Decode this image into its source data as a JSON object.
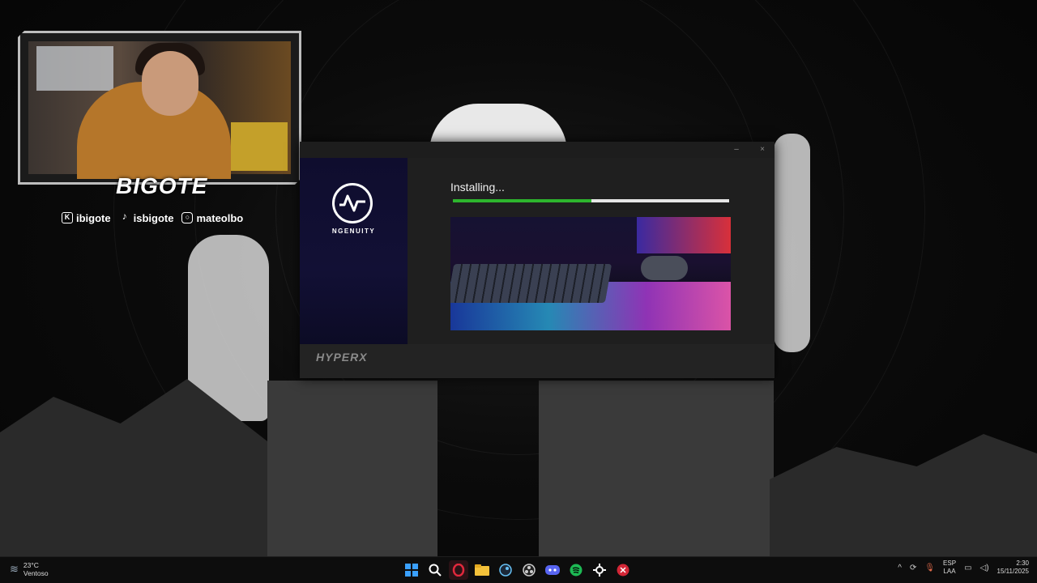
{
  "overlay": {
    "brand": "BIGOTE",
    "socials": [
      {
        "icon": "twitch-kick-icon",
        "label": "ibigote"
      },
      {
        "icon": "tiktok-icon",
        "label": "isbigote"
      },
      {
        "icon": "instagram-icon",
        "label": "mateolbo"
      }
    ]
  },
  "installer": {
    "app_name": "NGENUITY",
    "status": "Installing...",
    "progress": 0.5,
    "footer_brand": "HYPERX",
    "minimize": "–",
    "close": "×"
  },
  "taskbar": {
    "weather_temp": "23°C",
    "weather_desc": "Ventoso",
    "apps": [
      "start-icon",
      "search-icon",
      "opera-gx-icon",
      "file-explorer-icon",
      "steam-icon",
      "obs-icon",
      "discord-icon",
      "spotify-icon",
      "steelseries-icon",
      "app-red-icon"
    ],
    "lang_primary": "ESP",
    "lang_secondary": "LAA",
    "time": "2:30",
    "date": "15/11/2025"
  }
}
